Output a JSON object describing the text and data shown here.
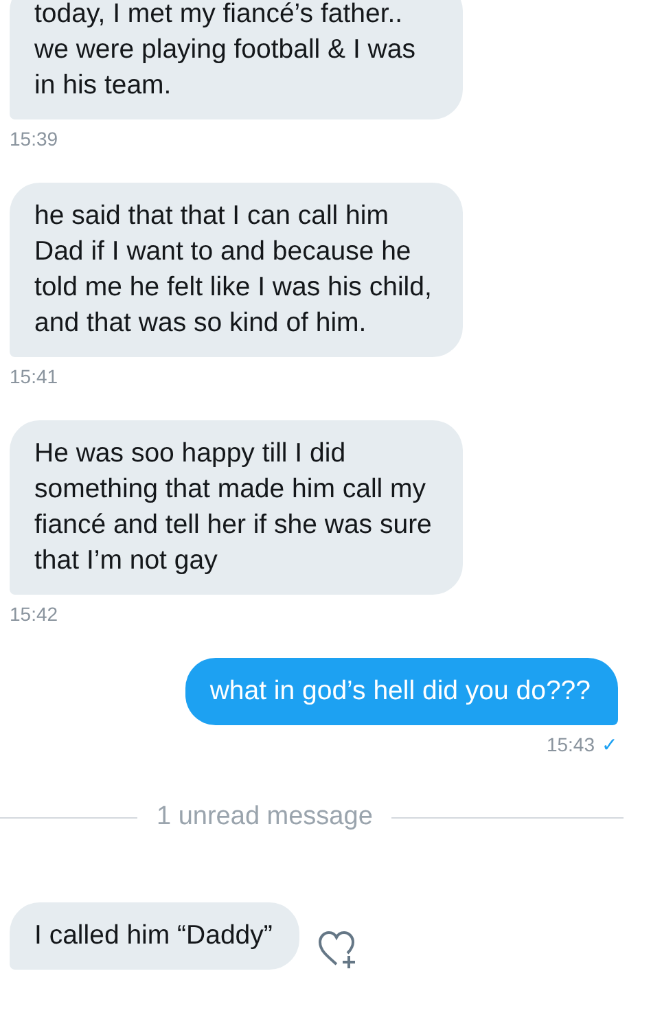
{
  "messages": [
    {
      "kind": "received",
      "text": "today, I met my fiancé’s father.. we were playing football & I was in his team.",
      "time": "15:39"
    },
    {
      "kind": "received",
      "text": "he said that that I can call him Dad if I want to and because he told me he felt like I was his child, and that was so kind of him.",
      "time": "15:41"
    },
    {
      "kind": "received",
      "text": "He was soo happy till I did something that made him call my fiancé and tell her if she was sure that I’m not gay",
      "time": "15:42"
    },
    {
      "kind": "sent",
      "text": "what in god’s hell did you do???",
      "time": "15:43",
      "status": "✓"
    },
    {
      "kind": "divider",
      "text": "1 unread message"
    },
    {
      "kind": "received",
      "text": "I called him “Daddy”",
      "reaction_button": true
    }
  ]
}
